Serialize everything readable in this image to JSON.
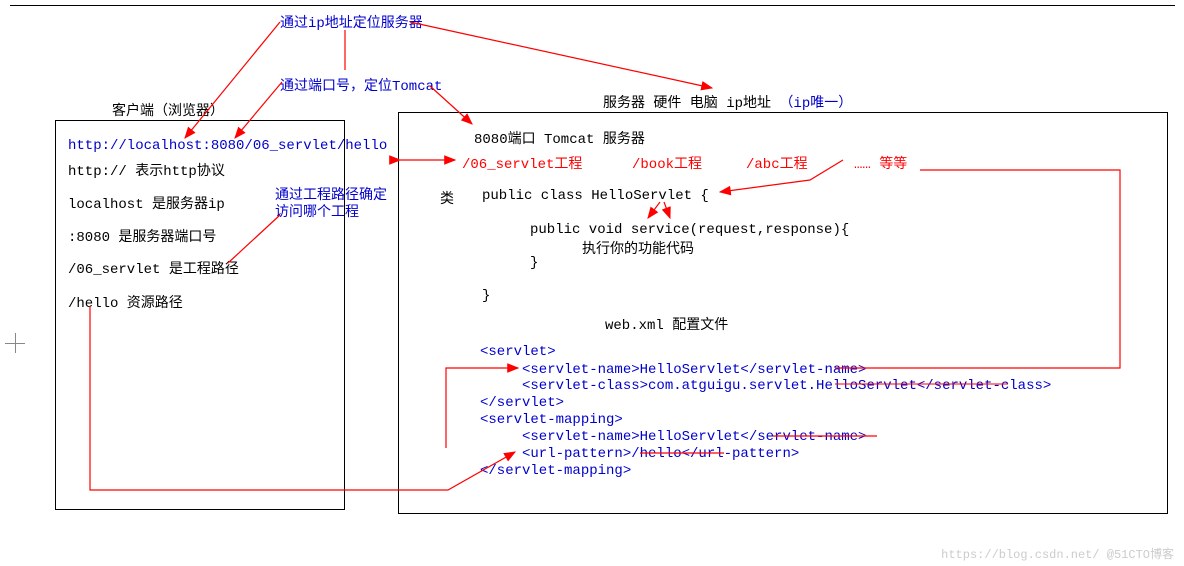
{
  "annotations": {
    "ip_locate": "通过ip地址定位服务器",
    "port_locate": "通过端口号，定位Tomcat",
    "project_path_locate": "通过工程路径确定访问哪个工程"
  },
  "client": {
    "title": "客户端（浏览器）",
    "url": "http://localhost:8080/06_servlet/hello",
    "lines": {
      "http": "http:// 表示http协议",
      "localhost": "localhost 是服务器ip",
      "port": ":8080 是服务器端口号",
      "project": "/06_servlet 是工程路径",
      "hello": "/hello  资源路径"
    }
  },
  "server": {
    "title": "服务器 硬件 电脑   ip地址  ",
    "ip_unique": "（ip唯一）",
    "port_label": "8080端口 Tomcat 服务器",
    "projects": {
      "p1": "/06_servlet工程",
      "p2": "/book工程",
      "p3": "/abc工程",
      "etc": "…… 等等"
    },
    "class_label": "类",
    "code": {
      "l1": "public class HelloServlet {",
      "l2": "public void service(request,response){",
      "l3": "执行你的功能代码",
      "l4": "}",
      "l5": "}"
    },
    "webxml_title": "web.xml 配置文件",
    "xml": {
      "l1": "<servlet>",
      "l2": "<servlet-name>HelloServlet</servlet-name>",
      "l3": "<servlet-class>com.atguigu.servlet.HelloServlet</servlet-class>",
      "l4": "</servlet>",
      "l5": "<servlet-mapping>",
      "l6": "<servlet-name>HelloServlet</servlet-name>",
      "l7": "<url-pattern>/hello</url-pattern>",
      "l8": "</servlet-mapping>"
    }
  },
  "watermark": "https://blog.csdn.net/  @51CTO博客"
}
